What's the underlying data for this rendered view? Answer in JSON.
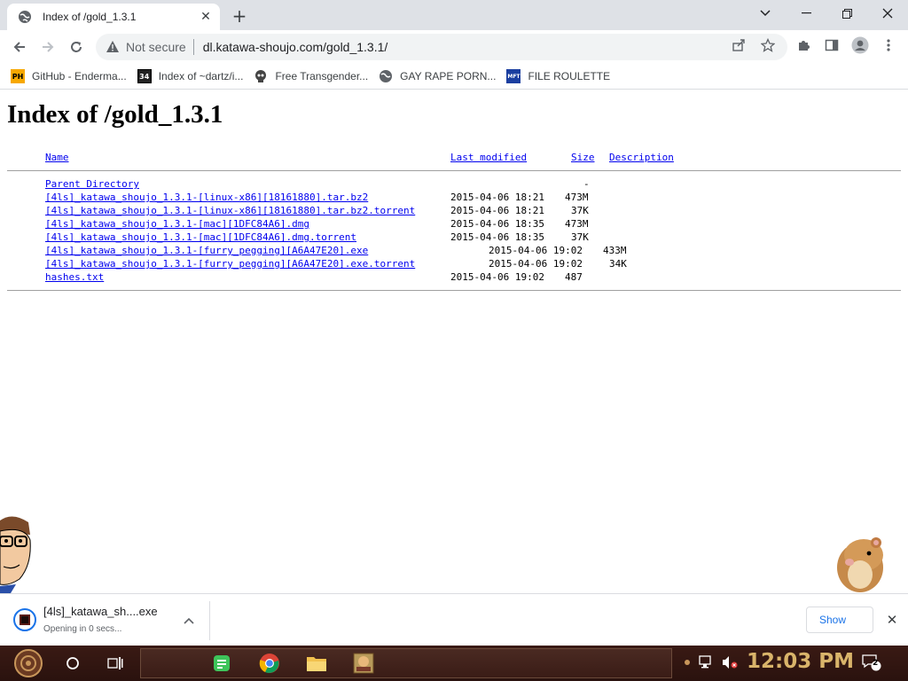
{
  "tab": {
    "title": "Index of /gold_1.3.1",
    "close": "✕",
    "new_tab": "+"
  },
  "window": {
    "minimize": "—",
    "restore": "❐",
    "close": "✕",
    "chevron": "⌄"
  },
  "omnibox": {
    "security": "Not secure",
    "url": "dl.katawa-shoujo.com/gold_1.3.1/"
  },
  "bookmarks": [
    {
      "label": "GitHub - Enderma...",
      "icon": "PH"
    },
    {
      "label": "Index of ~dartz/i...",
      "icon": "34"
    },
    {
      "label": "Free Transgender...",
      "icon": ""
    },
    {
      "label": "GAY RAPE PORN...",
      "icon": ""
    },
    {
      "label": "FILE ROULETTE",
      "icon": "MFT"
    }
  ],
  "page": {
    "title": "Index of /gold_1.3.1",
    "headers": {
      "name": "Name",
      "modified": "Last modified",
      "size": "Size",
      "description": "Description"
    },
    "parent": {
      "name": "Parent Directory",
      "size": "-"
    },
    "files": [
      {
        "name": "[4ls]_katawa_shoujo_1.3.1-[linux-x86][18161880].tar.bz2",
        "modified": "2015-04-06 18:21",
        "size": "473M"
      },
      {
        "name": "[4ls]_katawa_shoujo_1.3.1-[linux-x86][18161880].tar.bz2.torrent",
        "modified": "2015-04-06 18:21",
        "size": "37K"
      },
      {
        "name": "[4ls]_katawa_shoujo_1.3.1-[mac][1DFC84A6].dmg",
        "modified": "2015-04-06 18:35",
        "size": "473M"
      },
      {
        "name": "[4ls]_katawa_shoujo_1.3.1-[mac][1DFC84A6].dmg.torrent",
        "modified": "2015-04-06 18:35",
        "size": "37K"
      },
      {
        "name": "[4ls]_katawa_shoujo_1.3.1-[furry_pegging][A6A47E20].exe",
        "modified": "2015-04-06 19:02",
        "size": "433M"
      },
      {
        "name": "[4ls]_katawa_shoujo_1.3.1-[furry_pegging][A6A47E20].exe.torrent",
        "modified": "2015-04-06 19:02",
        "size": "34K"
      },
      {
        "name": "hashes.txt",
        "modified": "2015-04-06 19:02",
        "size": "487"
      }
    ]
  },
  "download": {
    "filename": "[4ls]_katawa_sh....exe",
    "status": "Opening in 0 secs...",
    "show_all": "Show",
    "close": "✕"
  },
  "taskbar": {
    "time": "12:03 PM",
    "notifications": "2"
  },
  "colors": {
    "link": "#0000ee",
    "accent": "#1a73e8",
    "taskbar": "#2a120e",
    "clock": "#d9b46a"
  }
}
